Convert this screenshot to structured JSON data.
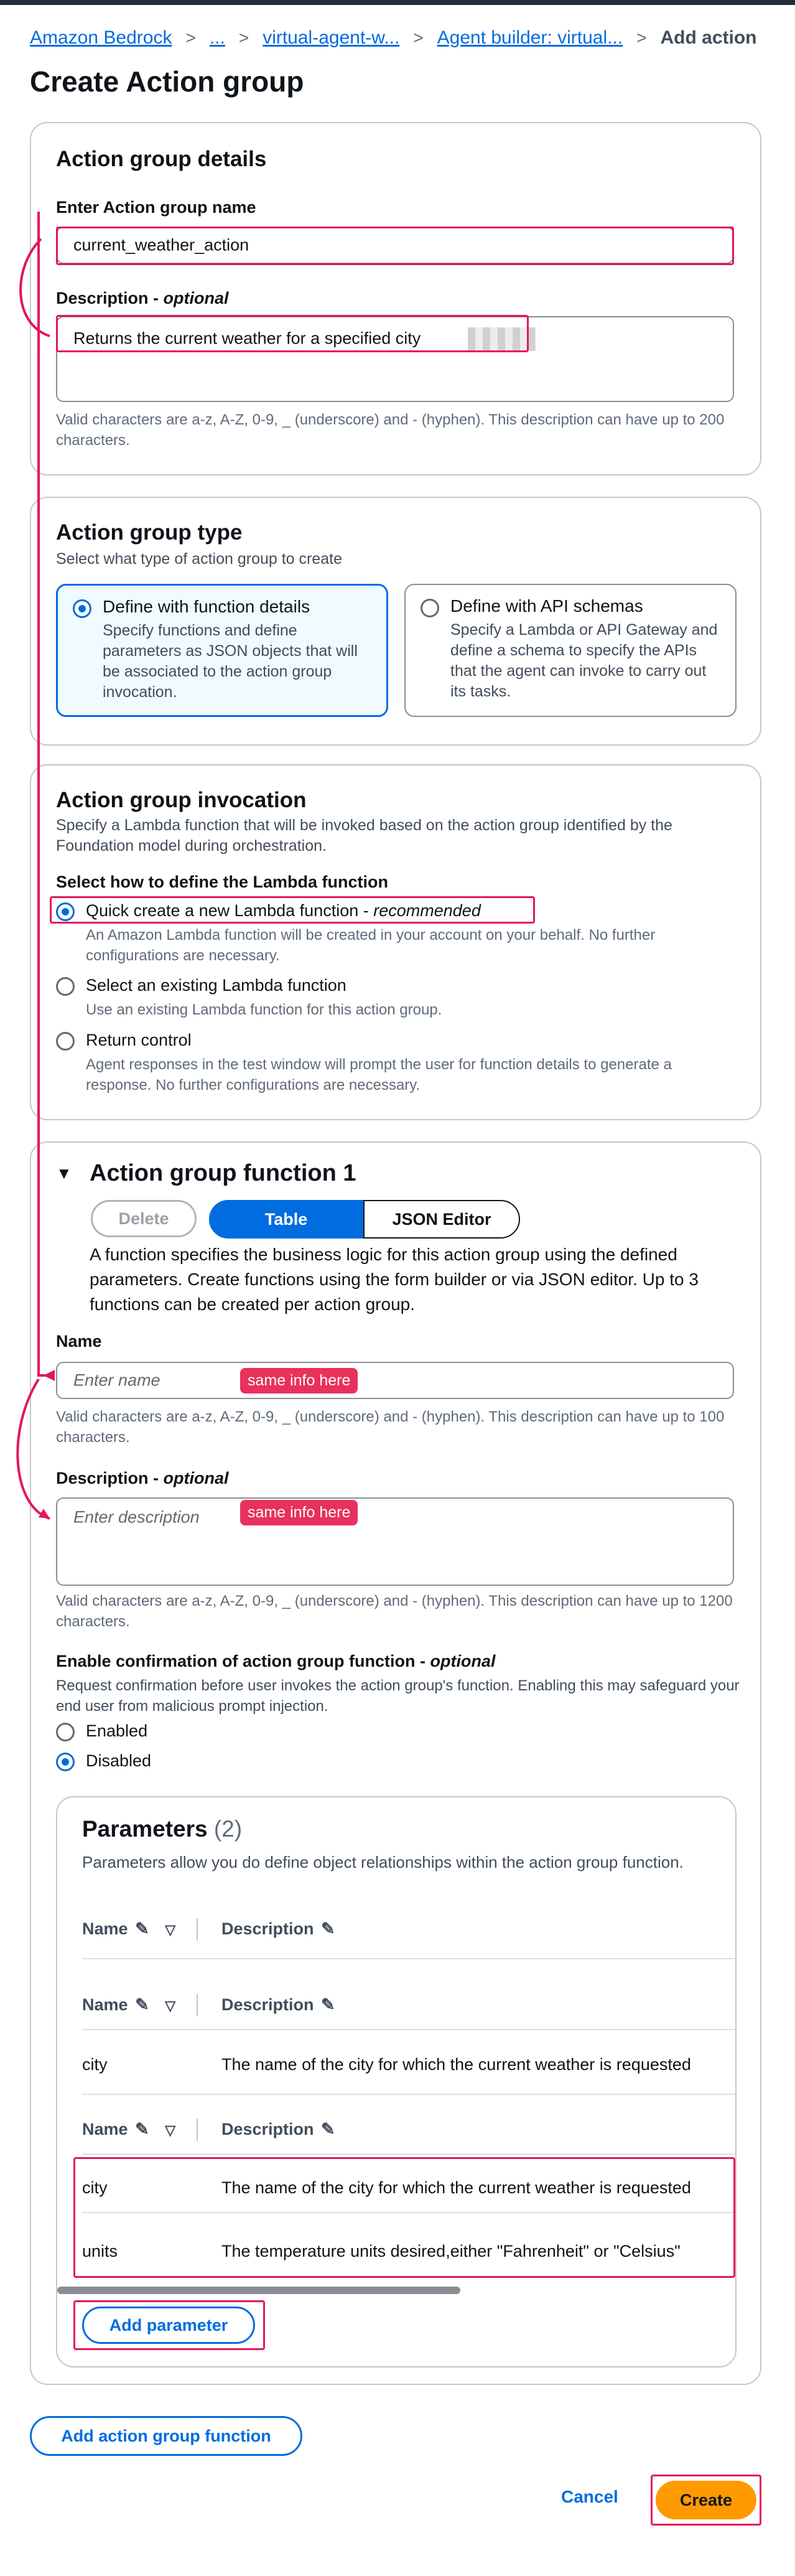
{
  "breadcrumb": [
    "Amazon Bedrock",
    "...",
    "virtual-agent-w...",
    "Agent builder: virtual...",
    "Add action"
  ],
  "page_title": "Create Action group",
  "details": {
    "heading": "Action group details",
    "name_label": "Enter Action group name",
    "name_value": "current_weather_action",
    "desc_label": "Description",
    "optional": "optional",
    "desc_value": "Returns the current weather for a specified city",
    "hint": "Valid characters are a-z, A-Z, 0-9, _ (underscore) and - (hyphen). This description can have up to 200 characters."
  },
  "type": {
    "heading": "Action group type",
    "sub": "Select what type of action group to create",
    "opt1_title": "Define with function details",
    "opt1_desc": "Specify functions and define parameters as JSON objects that will be associated to the action group invocation.",
    "opt2_title": "Define with API schemas",
    "opt2_desc": "Specify a Lambda or API Gateway and define a schema to specify the APIs that the agent can invoke to carry out its tasks."
  },
  "invocation": {
    "heading": "Action group invocation",
    "sub": "Specify a Lambda function that will be invoked based on the action group identified by the Foundation model during orchestration.",
    "select_label": "Select how to define the Lambda function",
    "opt1_title": "Quick create a new Lambda function",
    "opt1_rec": "recommended",
    "opt1_desc": "An Amazon Lambda function will be created in your account on your behalf. No further configurations are necessary.",
    "opt2_title": "Select an existing Lambda function",
    "opt2_desc": "Use an existing Lambda function for this action group.",
    "opt3_title": "Return control",
    "opt3_desc": "Agent responses in the test window will prompt the user for function details to generate a response. No further configurations are necessary."
  },
  "function": {
    "heading": "Action group function 1",
    "delete": "Delete",
    "table": "Table",
    "json": "JSON Editor",
    "desc": "A function specifies the business logic for this action group using the defined parameters. Create functions using the form builder or via JSON editor. Up to 3 functions can be created per action group.",
    "name_label": "Name",
    "name_placeholder": "Enter name",
    "name_tag": "same info here",
    "name_hint": "Valid characters are a-z, A-Z, 0-9, _ (underscore) and - (hyphen). This description can have up to 100 characters.",
    "desc_label": "Description",
    "optional": "optional",
    "desc_placeholder": "Enter description",
    "desc_tag": "same info here",
    "desc_hint": "Valid characters are a-z, A-Z, 0-9, _ (underscore) and - (hyphen). This description can have up to 1200 characters.",
    "confirm_label": "Enable confirmation of action group function",
    "confirm_desc": "Request confirmation before user invokes the action group's function. Enabling this may safeguard your end user from malicious prompt injection.",
    "enabled": "Enabled",
    "disabled": "Disabled"
  },
  "params": {
    "heading": "Parameters",
    "count": "(2)",
    "desc": "Parameters allow you do define object relationships within the action group function.",
    "col_name": "Name",
    "col_desc": "Description",
    "rows": [
      {
        "name": "city",
        "desc": "The name of the city for which the current weather is requested"
      },
      {
        "name": "city",
        "desc": "The name of the city for which the current weather is requested"
      },
      {
        "name": "units",
        "desc": "The temperature units desired,either \"Fahrenheit\" or \"Celsius\""
      }
    ],
    "add": "Add parameter"
  },
  "add_function": "Add action group function",
  "cancel": "Cancel",
  "create": "Create",
  "colors": {
    "accent": "#006ce0",
    "highlight": "#e3165b",
    "primary_button": "#ff9900"
  }
}
